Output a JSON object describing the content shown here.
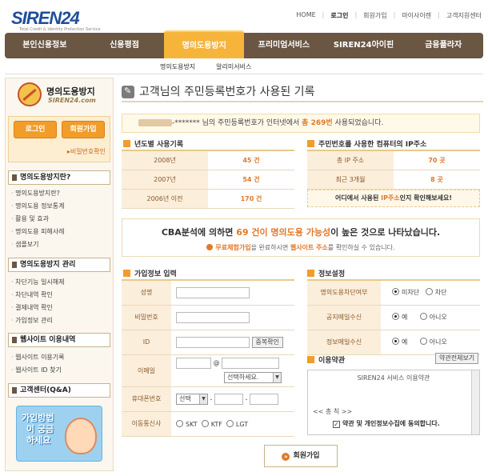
{
  "header": {
    "logo": "SIREN24",
    "logo_sub": "Total Credit & Identity Protection Service",
    "links": [
      "HOME",
      "로그인",
      "회원가입",
      "마이사이렌",
      "고객지원센터"
    ]
  },
  "nav": {
    "items": [
      "본인신용정보",
      "신용평점",
      "명의도용방지",
      "프리미엄서비스",
      "SIREN24아이핀",
      "금융플라자"
    ],
    "sub": [
      "명의도용방지",
      "알리미서비스"
    ]
  },
  "sidebar": {
    "logo_title": "명의도용방지",
    "logo_sub": "SIREN24.com",
    "login": "로그인",
    "join": "회원가입",
    "pwfind": "▸비밀번호확인",
    "sections": [
      {
        "title": "명의도용방지란?",
        "items": [
          "명의도용방지란?",
          "명의도용 정보통계",
          "활용 및 효과",
          "명의도용 피해사례",
          "샘플보기"
        ]
      },
      {
        "title": "명의도용방지 관리",
        "items": [
          "차단기능 일시해제",
          "차단내역 확인",
          "결제내역 확인",
          "가입정보 관리"
        ]
      },
      {
        "title": "웹사이트 이용내역",
        "items": [
          "웹사이트 이용기록",
          "웹사이트 ID 찾기"
        ]
      },
      {
        "title": "고객센터(Q&A)",
        "items": []
      }
    ],
    "promo": [
      "가입방법",
      "이 궁금",
      "하세요"
    ]
  },
  "main": {
    "title": "고객님의 주민등록번호가 사용된 기록",
    "notice_mask": "-*******",
    "notice_pre": "님의 주민등록번호가 인터넷에서",
    "notice_count": "총 269번",
    "notice_post": "사용되었습니다.",
    "yearly_title": "년도별 사용기록",
    "yearly": [
      {
        "label": "2008년",
        "value": "45 건"
      },
      {
        "label": "2007년",
        "value": "54 건"
      },
      {
        "label": "2006년 이전",
        "value": "170 건"
      }
    ],
    "ip_title": "주민번호를 사용한 컴퓨터의 IP주소",
    "ip": [
      {
        "label": "총 IP 주소",
        "value": "70 곳"
      },
      {
        "label": "최근 3개월",
        "value": "8 곳"
      }
    ],
    "ip_note_pre": "어디에서 사용된",
    "ip_note_hl": "IP주소",
    "ip_note_post": "인지 확인해보세요!",
    "cba_pre": "CBA분석에 의하면",
    "cba_hl": "69 건이 명의도용 가능성",
    "cba_post": "이 높은 것으로 나타났습니다.",
    "cba_sub_hl1": "무료체험가입",
    "cba_sub_mid": "을 완료하시면",
    "cba_sub_hl2": "웹사이트 주소",
    "cba_sub_post": "를 확인하실 수 있습니다.",
    "join_title": "가입정보 입력",
    "join_fields": [
      "성명",
      "비밀번호",
      "ID",
      "이메일",
      "휴대폰번호",
      "이동통신사"
    ],
    "dup_check": "중복확인",
    "email_at": "@",
    "email_select": "선택하세요.",
    "phone_select": "선택",
    "carriers": [
      "SKT",
      "KTF",
      "LGT"
    ],
    "info_title": "정보설정",
    "info_rows": [
      {
        "label": "명의도용차단여부",
        "opt1": "미차단",
        "opt2": "차단"
      },
      {
        "label": "공지메일수신",
        "opt1": "예",
        "opt2": "아니오"
      },
      {
        "label": "정보메일수신",
        "opt1": "예",
        "opt2": "아니오"
      }
    ],
    "terms_title": "이용약관",
    "terms_btn": "약관전체보기",
    "terms_text": "SIREN24 서비스 이용약관",
    "terms_sub": "<< 총 칙 >>",
    "terms_agree": "약관 및 개인정보수집에 동의합니다.",
    "submit": "회원가입"
  },
  "colors": {
    "brown": "#6b5643",
    "orange": "#f29c2a",
    "highlight": "#e0782a"
  }
}
